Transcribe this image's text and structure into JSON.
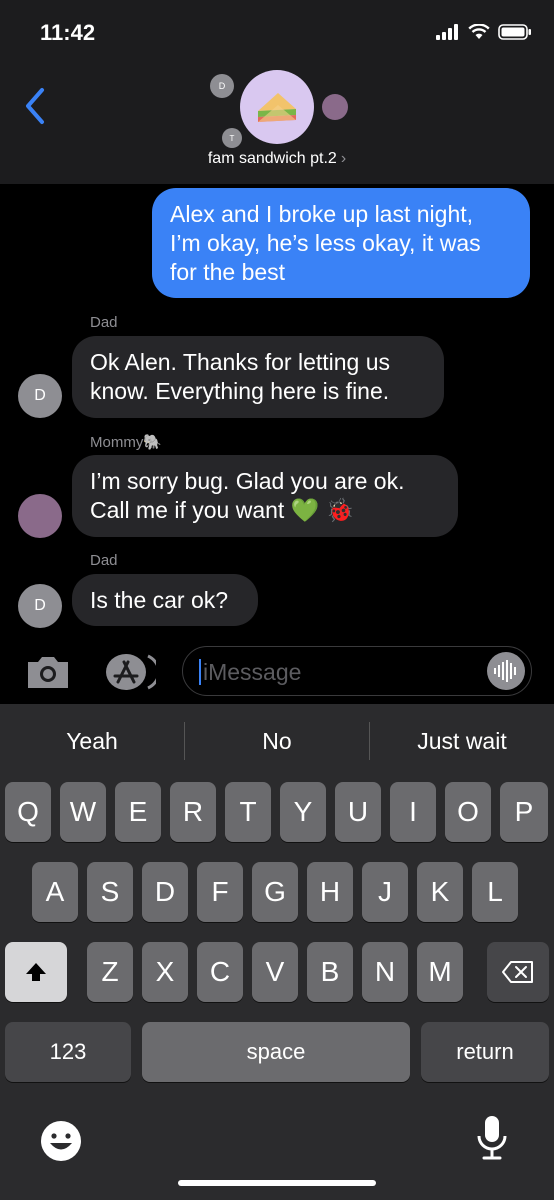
{
  "status": {
    "time": "11:42"
  },
  "header": {
    "group_name": "fam sandwich pt.2",
    "chevron": "›",
    "back_icon": "chevron-left-icon",
    "member_initials": [
      "D",
      "T"
    ]
  },
  "messages": [
    {
      "type": "sent",
      "text_lines": [
        "Alex and I broke up last night,",
        "I’m okay, he’s less okay, it was",
        "for the best"
      ]
    },
    {
      "type": "recv",
      "sender": "Dad",
      "avatar": "D",
      "text_lines": [
        "Ok Alen. Thanks for letting us",
        "know. Everything here is fine."
      ]
    },
    {
      "type": "recv",
      "sender": "Mommy🐘",
      "avatar_photo": true,
      "text_lines": [
        "I’m sorry bug. Glad you are ok.",
        "Call me if you want 💚 🐞"
      ]
    },
    {
      "type": "recv",
      "sender": "Dad",
      "avatar": "D",
      "text_lines": [
        "Is the car ok?"
      ]
    }
  ],
  "input": {
    "placeholder": "iMessage"
  },
  "keyboard": {
    "suggestions": [
      "Yeah",
      "No",
      "Just wait"
    ],
    "row1": [
      "Q",
      "W",
      "E",
      "R",
      "T",
      "Y",
      "U",
      "I",
      "O",
      "P"
    ],
    "row2": [
      "A",
      "S",
      "D",
      "F",
      "G",
      "H",
      "J",
      "K",
      "L"
    ],
    "row3": [
      "Z",
      "X",
      "C",
      "V",
      "B",
      "N",
      "M"
    ],
    "numbers_label": "123",
    "space_label": "space",
    "return_label": "return"
  },
  "colors": {
    "sent_bubble": "#3a82f6",
    "recv_bubble": "#262629",
    "accent": "#3a82f6"
  }
}
